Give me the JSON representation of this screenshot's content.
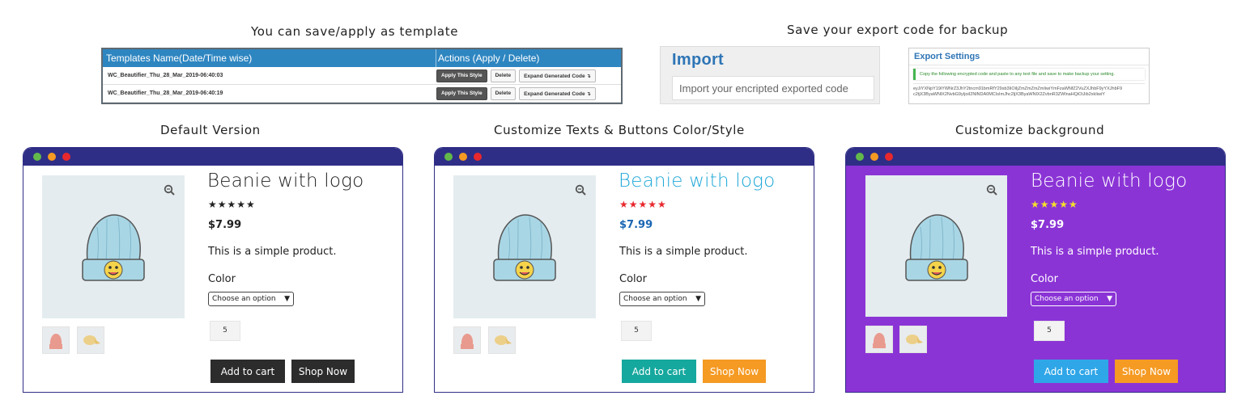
{
  "captions": {
    "template": "You can save/apply as template",
    "export": "Save your export code for backup",
    "default": "Default Version",
    "custom_texts": "Customize Texts & Buttons Color/Style",
    "custom_bg": "Customize background"
  },
  "templates_table": {
    "col_name": "Templates Name(Date/Time wise)",
    "col_actions": "Actions (Apply / Delete)",
    "rows": [
      {
        "name": "WC_Beautifier_Thu_28_Mar_2019-06:40:03"
      },
      {
        "name": "WC_Beautifier_Thu_28_Mar_2019-06:40:19"
      }
    ],
    "apply_label": "Apply This Style",
    "delete_label": "Delete",
    "expand_label": "Expand Generated Code ↴"
  },
  "import_panel": {
    "title": "Import",
    "placeholder": "Import your encripted exported code"
  },
  "export_panel": {
    "title": "Export Settings",
    "note": "Copy the following encrypted code and paste to any text file and save to make backup your setting.",
    "code_line1": "eyJiYXNpY19iYWNrZ3JhY2tncm91bmRfY29sb3IiOiIjZmZmZmZmIiwiYmFzaWNfZ2VuZXJhbF9yYXJhbF9",
    "code_line2": "c2tjX3ByaWNlX2NvbG9yIjoiI2NlNDA0MCIsImJhc2ljX3ByaWNlX2ZvbnR3ZWlnaHQiOiJib2xkIiwiY"
  },
  "product": {
    "title": "Beanie with logo",
    "stars": "★★★★★",
    "price": "$7.99",
    "description": "This is a simple product.",
    "color_label": "Color",
    "select_value": "Choose an option",
    "quantity": "5",
    "add_to_cart": "Add to cart",
    "shop_now": "Shop Now"
  },
  "colors": {
    "window_bar": "#2f2e86",
    "purple_bg": "#8b34d6",
    "custom_title": "#1fa8d8",
    "custom_stars": "#e8282d",
    "custom_price": "#1a66b3",
    "teal_button": "#15a89e",
    "orange_button": "#f59a23",
    "blue_button": "#2fa6e8",
    "yellow_stars": "#f5e12a"
  }
}
